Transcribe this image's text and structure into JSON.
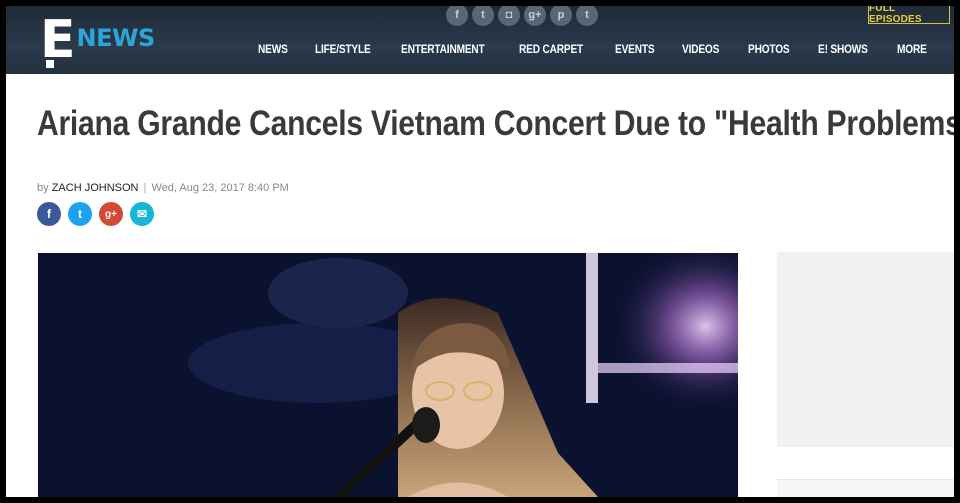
{
  "header": {
    "logo_letter": "E",
    "logo_word": "NEWS",
    "social": [
      {
        "icon": "facebook-icon",
        "glyph": "f"
      },
      {
        "icon": "twitter-icon",
        "glyph": "t"
      },
      {
        "icon": "instagram-icon",
        "glyph": "◘"
      },
      {
        "icon": "google-plus-icon",
        "glyph": "g+"
      },
      {
        "icon": "pinterest-icon",
        "glyph": "p"
      },
      {
        "icon": "tumblr-icon",
        "glyph": "t"
      }
    ],
    "full_episodes": "FULL EPISODES",
    "nav": [
      "NEWS",
      "LIFE/STYLE",
      "ENTERTAINMENT",
      "RED CARPET",
      "EVENTS",
      "VIDEOS",
      "PHOTOS",
      "E! SHOWS",
      "MORE"
    ]
  },
  "article": {
    "headline": "Ariana Grande Cancels Vietnam Concert Due to \"Health Problems\"",
    "by": "by",
    "author": "ZACH JOHNSON",
    "separator": "|",
    "date": "Wed, Aug 23, 2017 8:40 PM",
    "share": [
      {
        "icon": "facebook-icon",
        "glyph": "f"
      },
      {
        "icon": "twitter-icon",
        "glyph": "t"
      },
      {
        "icon": "google-plus-icon",
        "glyph": "g+"
      },
      {
        "icon": "email-icon",
        "glyph": "✉"
      }
    ]
  },
  "colors": {
    "header_bg": "#26303d",
    "brand_blue": "#2ba6d9",
    "full_episodes_gold": "#e6cf3b",
    "facebook": "#3b5998",
    "twitter": "#1da1f2",
    "google_plus": "#d34836",
    "email": "#15b6d8"
  }
}
